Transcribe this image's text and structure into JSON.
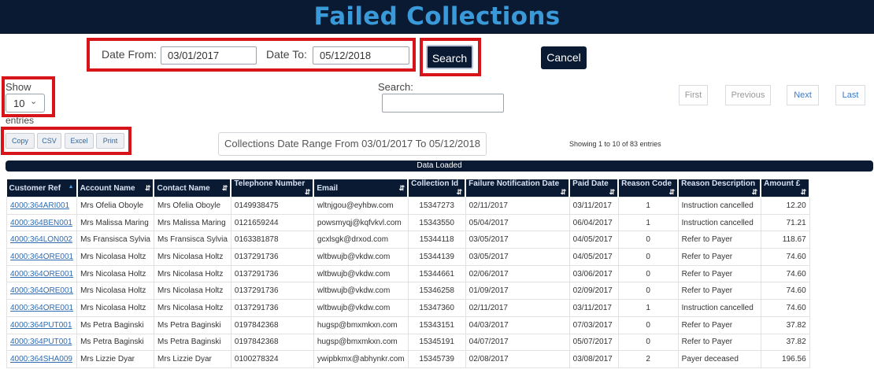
{
  "header": {
    "title": "Failed Collections"
  },
  "filters": {
    "date_from_label": "Date From:",
    "date_from_value": "03/01/2017",
    "date_to_label": "Date To:",
    "date_to_value": "05/12/2018",
    "search_button": "Search",
    "cancel_button": "Cancel"
  },
  "length": {
    "show_label": "Show",
    "value": "10",
    "entries_label": "entries"
  },
  "search": {
    "label": "Search:",
    "value": ""
  },
  "pagination": {
    "first": "First",
    "previous": "Previous",
    "next": "Next",
    "last": "Last"
  },
  "export": {
    "copy": "Copy",
    "csv": "CSV",
    "excel": "Excel",
    "print": "Print"
  },
  "range_text": "Collections Date Range From 03/01/2017 To 05/12/2018",
  "info_text": "Showing 1 to 10 of 83 entries",
  "status_bar": "Data Loaded",
  "table": {
    "columns": [
      "Customer Ref",
      "Account Name",
      "Contact Name",
      "Telephone Number",
      "Email",
      "Collection Id",
      "Failure Notification Date",
      "Paid Date",
      "Reason Code",
      "Reason Description",
      "Amount £"
    ],
    "rows": [
      [
        "4000:364ARI001",
        "Mrs Ofelia Oboyle",
        "Mrs Ofelia Oboyle",
        "0149938475",
        "wltnjgou@eyhbw.com",
        "15347273",
        "02/11/2017",
        "03/11/2017",
        "1",
        "Instruction cancelled",
        "12.20"
      ],
      [
        "4000:364BEN001",
        "Mrs Malissa Maring",
        "Mrs Malissa Maring",
        "0121659244",
        "powsmyqj@kqfvkvl.com",
        "15343550",
        "05/04/2017",
        "06/04/2017",
        "1",
        "Instruction cancelled",
        "71.21"
      ],
      [
        "4000:364LON002",
        "Ms Fransisca Sylvia",
        "Ms Fransisca Sylvia",
        "0163381878",
        "gcxlsgk@drxod.com",
        "15344118",
        "03/05/2017",
        "04/05/2017",
        "0",
        "Refer to Payer",
        "118.67"
      ],
      [
        "4000:364ORE001",
        "Mrs Nicolasa Holtz",
        "Mrs Nicolasa Holtz",
        "0137291736",
        "wltbwujb@vkdw.com",
        "15344139",
        "03/05/2017",
        "04/05/2017",
        "0",
        "Refer to Payer",
        "74.60"
      ],
      [
        "4000:364ORE001",
        "Mrs Nicolasa Holtz",
        "Mrs Nicolasa Holtz",
        "0137291736",
        "wltbwujb@vkdw.com",
        "15344661",
        "02/06/2017",
        "03/06/2017",
        "0",
        "Refer to Payer",
        "74.60"
      ],
      [
        "4000:364ORE001",
        "Mrs Nicolasa Holtz",
        "Mrs Nicolasa Holtz",
        "0137291736",
        "wltbwujb@vkdw.com",
        "15346258",
        "01/09/2017",
        "02/09/2017",
        "0",
        "Refer to Payer",
        "74.60"
      ],
      [
        "4000:364ORE001",
        "Mrs Nicolasa Holtz",
        "Mrs Nicolasa Holtz",
        "0137291736",
        "wltbwujb@vkdw.com",
        "15347360",
        "02/11/2017",
        "03/11/2017",
        "1",
        "Instruction cancelled",
        "74.60"
      ],
      [
        "4000:364PUT001",
        "Ms Petra Baginski",
        "Ms Petra Baginski",
        "0197842368",
        "hugsp@bmxmkxn.com",
        "15343151",
        "04/03/2017",
        "07/03/2017",
        "0",
        "Refer to Payer",
        "37.82"
      ],
      [
        "4000:364PUT001",
        "Ms Petra Baginski",
        "Ms Petra Baginski",
        "0197842368",
        "hugsp@bmxmkxn.com",
        "15345191",
        "04/07/2017",
        "05/07/2017",
        "0",
        "Refer to Payer",
        "37.82"
      ],
      [
        "4000:364SHA009",
        "Mrs Lizzie Dyar",
        "Mrs Lizzie Dyar",
        "0100278324",
        "ywipbkmx@abhynkr.com",
        "15345739",
        "02/08/2017",
        "03/08/2017",
        "2",
        "Payer deceased",
        "196.56"
      ]
    ]
  }
}
